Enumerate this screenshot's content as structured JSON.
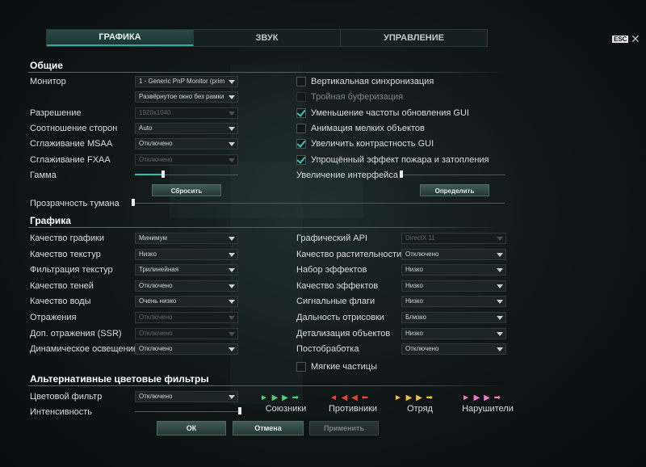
{
  "tabs": [
    "ГРАФИКА",
    "ЗВУК",
    "УПРАВЛЕНИЕ"
  ],
  "esc_label": "ESC",
  "close_glyph": "✕",
  "general": {
    "title": "Общие",
    "monitor": {
      "label": "Монитор",
      "value": "1 - Generic PnP Monitor (prim"
    },
    "window_mode": {
      "value": "Развёрнутое окно без рамки"
    },
    "resolution": {
      "label": "Разрешение",
      "value": "1920x1040"
    },
    "aspect": {
      "label": "Соотношение сторон",
      "value": "Auto"
    },
    "msaa": {
      "label": "Сглаживание MSAA",
      "value": "Отключено"
    },
    "fxaa": {
      "label": "Сглаживание FXAA",
      "value": "Отключено"
    },
    "gamma": {
      "label": "Гамма",
      "reset_label": "Сбросить",
      "level": 0.27
    },
    "fog": {
      "label": "Прозрачность тумана",
      "level": 0.0
    },
    "checkboxes": [
      {
        "label": "Вертикальная синхронизация",
        "checked": false,
        "disabled": false
      },
      {
        "label": "Тройная буферизация",
        "checked": false,
        "disabled": true
      },
      {
        "label": "Уменьшение частоты обновления GUI",
        "checked": true,
        "disabled": false
      },
      {
        "label": "Анимация мелких объектов",
        "checked": false,
        "disabled": false
      },
      {
        "label": "Увеличить контрастность GUI",
        "checked": true,
        "disabled": false
      },
      {
        "label": "Упрощённый эффект пожара и затопления",
        "checked": true,
        "disabled": false
      }
    ],
    "ui_scale": {
      "label": "Увеличение интерфейса",
      "detect_label": "Определить",
      "level": 0.0
    }
  },
  "graphics": {
    "title": "Графика",
    "left": [
      {
        "label": "Качество графики",
        "value": "Минимум",
        "disabled": false
      },
      {
        "label": "Качество текстур",
        "value": "Низко",
        "disabled": false
      },
      {
        "label": "Фильтрация текстур",
        "value": "Трилинейная",
        "disabled": false
      },
      {
        "label": "Качество теней",
        "value": "Отключено",
        "disabled": false
      },
      {
        "label": "Качество воды",
        "value": "Очень низко",
        "disabled": false
      },
      {
        "label": "Отражения",
        "value": "Отключено",
        "disabled": true
      },
      {
        "label": "Доп. отражения (SSR)",
        "value": "Отключено",
        "disabled": true
      },
      {
        "label": "Динамическое освещение",
        "value": "Отключено",
        "disabled": false
      }
    ],
    "right": [
      {
        "label": "Графический API",
        "value": "DirectX 11",
        "disabled": true
      },
      {
        "label": "Качество растительности",
        "value": "Отключено",
        "disabled": false
      },
      {
        "label": "Набор эффектов",
        "value": "Низко",
        "disabled": false
      },
      {
        "label": "Качество эффектов",
        "value": "Низко",
        "disabled": false
      },
      {
        "label": "Сигнальные флаги",
        "value": "Низко",
        "disabled": false
      },
      {
        "label": "Дальность отрисовки",
        "value": "Близко",
        "disabled": false
      },
      {
        "label": "Детализация объектов",
        "value": "Низко",
        "disabled": false
      },
      {
        "label": "Постобработка",
        "value": "Отключено",
        "disabled": false
      }
    ],
    "soft_particles": {
      "label": "Мягкие частицы",
      "checked": false
    }
  },
  "color_filters": {
    "title": "Альтернативные цветовые фильтры",
    "filter": {
      "label": "Цветовой фильтр",
      "value": "Отключено"
    },
    "intensity": {
      "label": "Интенсивность",
      "level": 1.0
    },
    "swatches": [
      {
        "label": "Союзники",
        "color": "#4fd07a"
      },
      {
        "label": "Противники",
        "color": "#e8452d"
      },
      {
        "label": "Отряд",
        "color": "#f0c23a"
      },
      {
        "label": "Нарушители",
        "color": "#f07ac8"
      }
    ]
  },
  "footer": {
    "ok": "ОК",
    "cancel": "Отмена",
    "apply": "Применить"
  }
}
